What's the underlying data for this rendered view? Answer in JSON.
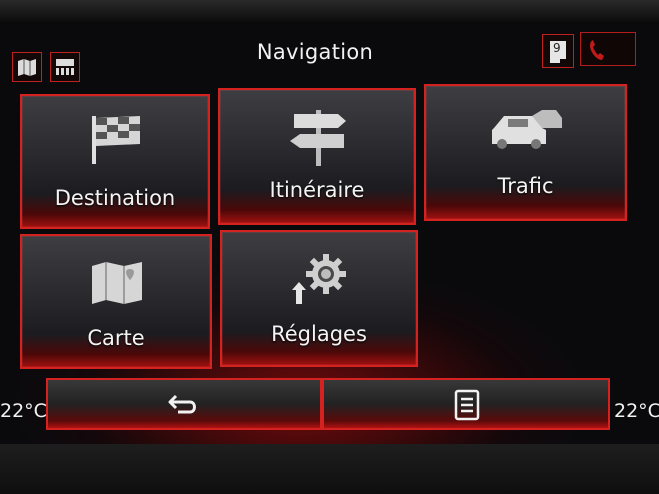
{
  "header": {
    "title": "Navigation",
    "left_icons": [
      "map-icon",
      "audio-station-icon"
    ],
    "right_icons": [
      "message-icon",
      "phone-icon"
    ],
    "message_count": "9"
  },
  "tiles": [
    {
      "label": "Destination",
      "icon": "checkered-flag-icon"
    },
    {
      "label": "Itinéraire",
      "icon": "signpost-icon"
    },
    {
      "label": "Trafic",
      "icon": "traffic-cars-icon"
    },
    {
      "label": "Carte",
      "icon": "map-icon"
    },
    {
      "label": "Réglages",
      "icon": "settings-gear-icon"
    }
  ],
  "footer": {
    "temp_left": "22°C",
    "temp_right": "22°C",
    "back_icon": "back-arrow-icon",
    "menu_icon": "list-menu-icon"
  },
  "colors": {
    "accent_red": "#d3221f",
    "text": "#f4f4f4",
    "background": "#0a0a0d"
  }
}
